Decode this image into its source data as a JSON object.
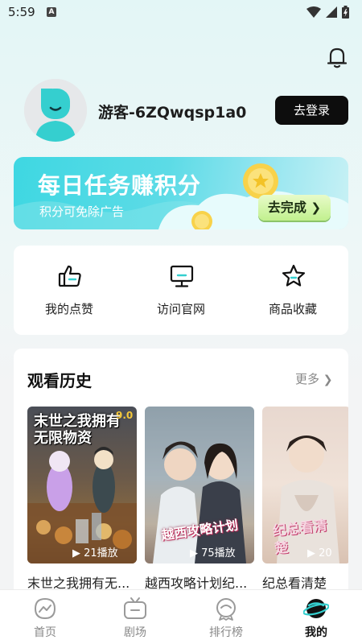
{
  "status_bar": {
    "time": "5:59",
    "app_badge": "A"
  },
  "profile": {
    "username": "游客-6ZQwqsp1a0",
    "login_label": "去登录"
  },
  "banner": {
    "title": "每日任务赚积分",
    "subtitle": "积分可免除广告",
    "button_label": "去完成"
  },
  "quick_actions": [
    {
      "label": "我的点赞",
      "icon": "thumbs-up-icon"
    },
    {
      "label": "访问官网",
      "icon": "monitor-icon"
    },
    {
      "label": "商品收藏",
      "icon": "star-icon"
    }
  ],
  "history": {
    "title": "观看历史",
    "more_label": "更多",
    "items": [
      {
        "title": "末世之我拥有无...",
        "plays": "21播放",
        "poster_text": "末世之我拥有无限物资",
        "rating": "9.0"
      },
      {
        "title": "越西攻略计划纪...",
        "plays": "75播放",
        "poster_text": "越西攻略计划"
      },
      {
        "title": "纪总看清楚",
        "plays": "20",
        "poster_text": "纪总看清楚"
      }
    ]
  },
  "tabs": [
    {
      "label": "首页",
      "icon": "home-chart-icon"
    },
    {
      "label": "剧场",
      "icon": "tv-icon"
    },
    {
      "label": "排行榜",
      "icon": "ranking-icon"
    },
    {
      "label": "我的",
      "icon": "planet-icon",
      "active": true
    }
  ],
  "colors": {
    "accent": "#3ed7e2",
    "login_bg": "#0d0d0d",
    "avatar_face": "#35cfcf"
  }
}
